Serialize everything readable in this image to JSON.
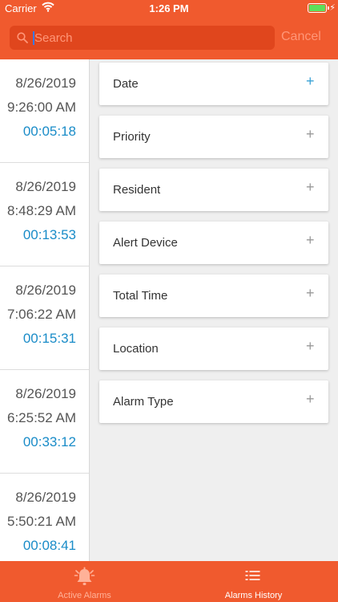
{
  "status_bar": {
    "carrier": "Carrier",
    "time": "1:26 PM",
    "battery_level": 1.0
  },
  "search": {
    "placeholder": "Search",
    "value": "",
    "cancel_label": "Cancel"
  },
  "alarms": [
    {
      "date": "8/26/2019",
      "time": "9:26:00 AM",
      "duration": "00:05:18"
    },
    {
      "date": "8/26/2019",
      "time": "8:48:29 AM",
      "duration": "00:13:53"
    },
    {
      "date": "8/26/2019",
      "time": "7:06:22 AM",
      "duration": "00:15:31"
    },
    {
      "date": "8/26/2019",
      "time": "6:25:52 AM",
      "duration": "00:33:12"
    },
    {
      "date": "8/26/2019",
      "time": "5:50:21 AM",
      "duration": "00:08:41"
    }
  ],
  "filters": [
    {
      "label": "Date"
    },
    {
      "label": "Priority"
    },
    {
      "label": "Resident"
    },
    {
      "label": "Alert Device"
    },
    {
      "label": "Total Time"
    },
    {
      "label": "Location"
    },
    {
      "label": "Alarm Type"
    }
  ],
  "plus_glyph": "+",
  "tabs": [
    {
      "label": "Active Alarms",
      "icon": "bell-icon"
    },
    {
      "label": "Alarms History",
      "icon": "list-icon"
    }
  ],
  "colors": {
    "brand": "#f05a2e",
    "duration": "#1a8cc8",
    "battery": "#5ee05a"
  }
}
